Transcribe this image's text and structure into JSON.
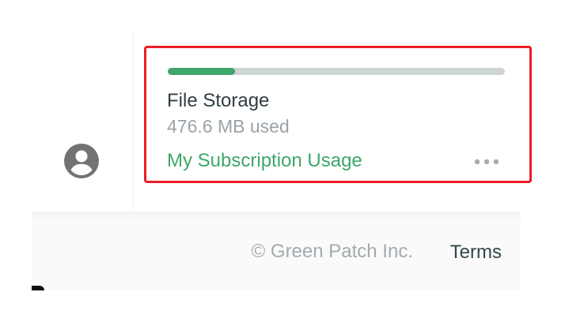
{
  "sidebar": {
    "avatar_icon": "account-circle-icon"
  },
  "storage": {
    "title": "File Storage",
    "used": "476.6 MB used",
    "usage_fraction": 0.2,
    "link_label": "My Subscription Usage",
    "more_icon": "more-horizontal-icon",
    "colors": {
      "accent": "#3ea769",
      "track": "#cfd4d6",
      "highlight_border": "#ea1d25"
    }
  },
  "footer": {
    "copyright": "© Green Patch Inc.",
    "terms_label": "Terms"
  }
}
